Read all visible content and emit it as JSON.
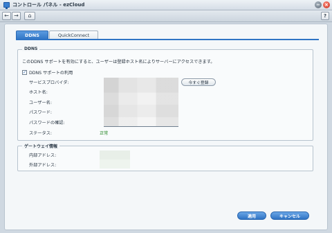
{
  "window": {
    "title": "コントロール パネル - ezCloud",
    "minimize_label": "−",
    "close_label": "×"
  },
  "toolbar": {
    "back_label": "←",
    "forward_label": "→",
    "home_label": "⌂",
    "help_label": "?"
  },
  "tabs": [
    {
      "label": "DDNS",
      "active": true
    },
    {
      "label": "QuickConnect",
      "active": false
    }
  ],
  "ddns": {
    "legend": "DDNS",
    "description": "このDDNS サポートを有効にすると、ユーザーは登録ホスト名によりサーバーにアクセスできます。",
    "enable_label": "DDNS サポートの利用",
    "enable_checked": "✓",
    "fields": {
      "provider": "サービスプロバイダ:",
      "hostname": "ホスト名:",
      "username": "ユーザー名:",
      "password": "パスワード:",
      "password_confirm": "パスワードの確認:",
      "status": "ステータス:"
    },
    "status_value": "正常",
    "update_now_label": "今すぐ登録"
  },
  "gateway": {
    "legend": "ゲートウェイ情報",
    "internal_label": "内部アドレス:",
    "external_label": "外部アドレス:"
  },
  "buttons": {
    "apply": "適用",
    "cancel": "キャンセル"
  },
  "colors": {
    "accent": "#2f74c4",
    "status_ok": "#2a8a2a",
    "close": "#c42a1a"
  }
}
